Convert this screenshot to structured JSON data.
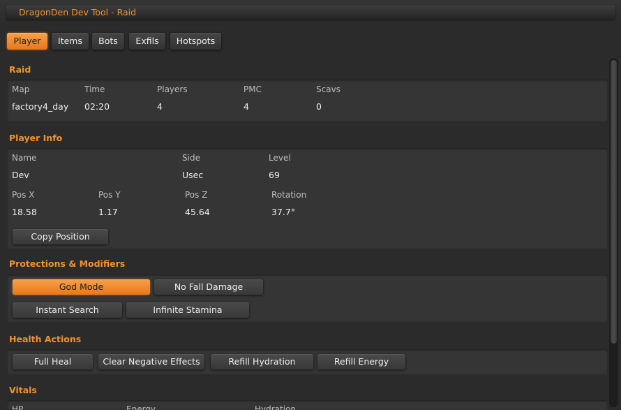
{
  "window": {
    "title": "DragonDen Dev Tool - Raid"
  },
  "tabs": [
    "Player",
    "Items",
    "Bots",
    "Exfils",
    "Hotspots"
  ],
  "active_tab": "Player",
  "raid": {
    "title": "Raid",
    "headers": [
      "Map",
      "Time",
      "Players",
      "PMC",
      "Scavs"
    ],
    "values": [
      "factory4_day",
      "02:20",
      "4",
      "4",
      "0"
    ]
  },
  "player_info": {
    "title": "Player Info",
    "row1_headers": [
      "Name",
      "Side",
      "Level"
    ],
    "row1_values": [
      "Dev",
      "Usec",
      "69"
    ],
    "row2_headers": [
      "Pos X",
      "Pos Y",
      "Pos Z",
      "Rotation"
    ],
    "row2_values": [
      "18.58",
      "1.17",
      "45.64",
      "37.7°"
    ],
    "copy_button": "Copy Position"
  },
  "protections": {
    "title": "Protections & Modifiers",
    "buttons": [
      {
        "label": "God Mode",
        "active": true
      },
      {
        "label": "No Fall Damage",
        "active": false
      },
      {
        "label": "Instant Search",
        "active": false
      },
      {
        "label": "Infinite Stamina",
        "active": false
      }
    ]
  },
  "health_actions": {
    "title": "Health Actions",
    "buttons": [
      "Full Heal",
      "Clear Negative Effects",
      "Refill Hydration",
      "Refill Energy"
    ]
  },
  "vitals": {
    "title": "Vitals",
    "headers": [
      "HP",
      "Energy",
      "Hydration"
    ]
  },
  "colors": {
    "accent": "#f0922e",
    "active_button": "#e8781a",
    "background": "#2b2b2b",
    "panel": "#353535"
  }
}
